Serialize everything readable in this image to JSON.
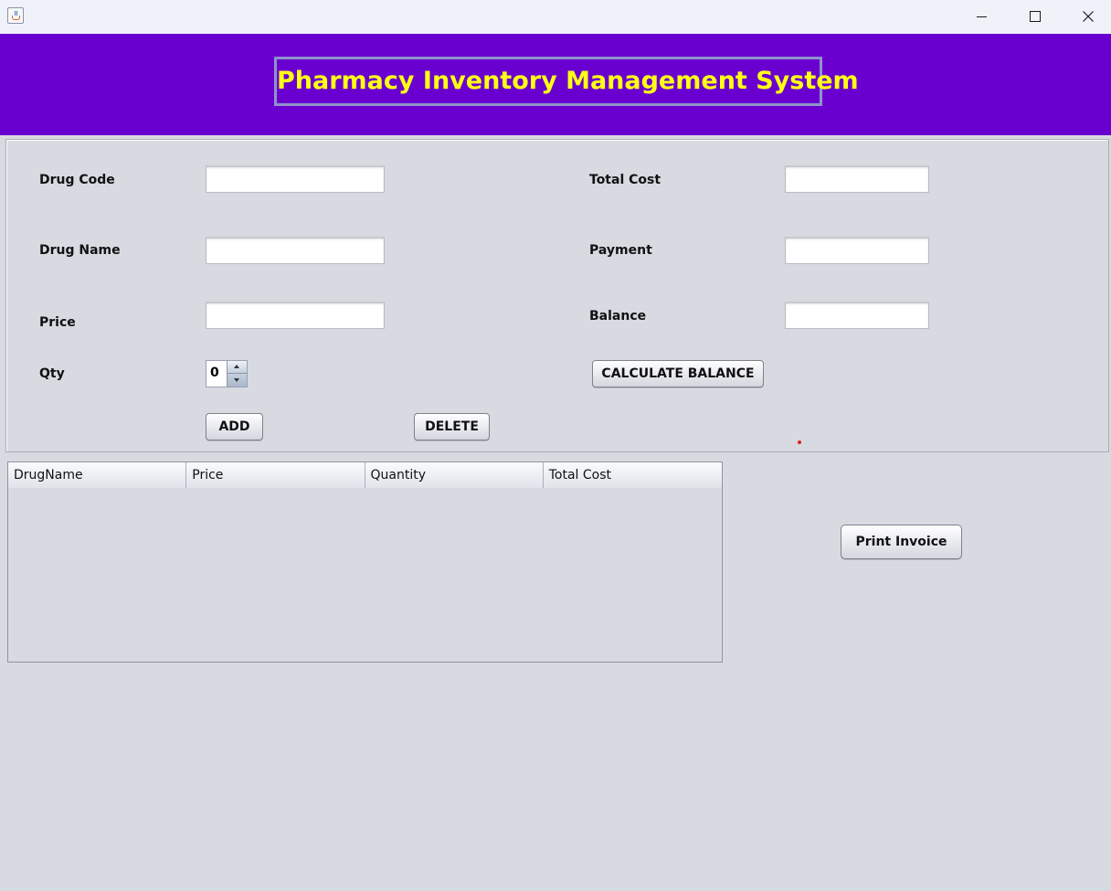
{
  "window": {
    "title": "",
    "controls": {
      "minimize_icon": "minimize-icon",
      "maximize_icon": "maximize-icon",
      "close_icon": "close-icon"
    }
  },
  "header": {
    "title": "Pharmacy Inventory Management System",
    "background": "#6a00d0",
    "title_color": "#ffff14"
  },
  "form": {
    "drug_code": {
      "label": "Drug Code",
      "value": ""
    },
    "drug_name": {
      "label": "Drug Name",
      "value": ""
    },
    "price": {
      "label": "Price",
      "value": ""
    },
    "qty": {
      "label": "Qty",
      "value": "0"
    },
    "total_cost": {
      "label": "Total Cost",
      "value": ""
    },
    "payment": {
      "label": "Payment",
      "value": ""
    },
    "balance": {
      "label": "Balance",
      "value": ""
    },
    "add_label": "ADD",
    "delete_label": "DELETE",
    "calculate_label": "CALCULATE BALANCE"
  },
  "table": {
    "columns": [
      "DrugName",
      "Price",
      "Quantity",
      "Total Cost"
    ],
    "rows": []
  },
  "print_label": "Print Invoice"
}
